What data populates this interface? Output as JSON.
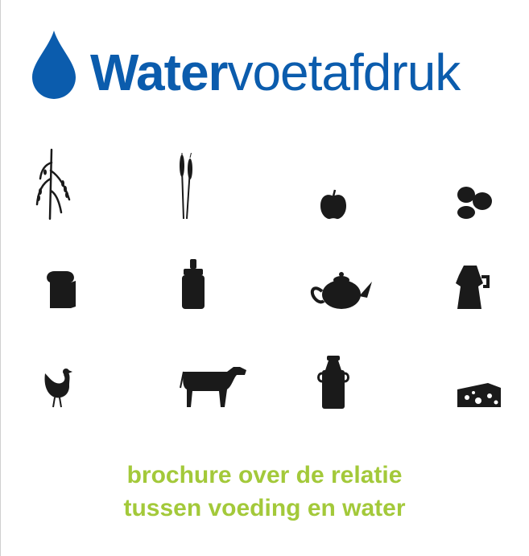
{
  "header": {
    "brand_bold": "Water",
    "brand_light": "voetafdruk",
    "drop_icon": "water-drop-icon",
    "brand_color": "#0b5cad"
  },
  "icons": [
    "rice-plant-icon",
    "wheat-icon",
    "apple-icon",
    "potatoes-icon",
    "bread-icon",
    "sugar-canister-icon",
    "teapot-icon",
    "coffee-pot-icon",
    "chicken-icon",
    "cow-icon",
    "milk-can-icon",
    "cheese-icon"
  ],
  "tagline": {
    "line1": "brochure over de relatie",
    "line2": "tussen voeding en water",
    "color": "#a3c93a"
  }
}
